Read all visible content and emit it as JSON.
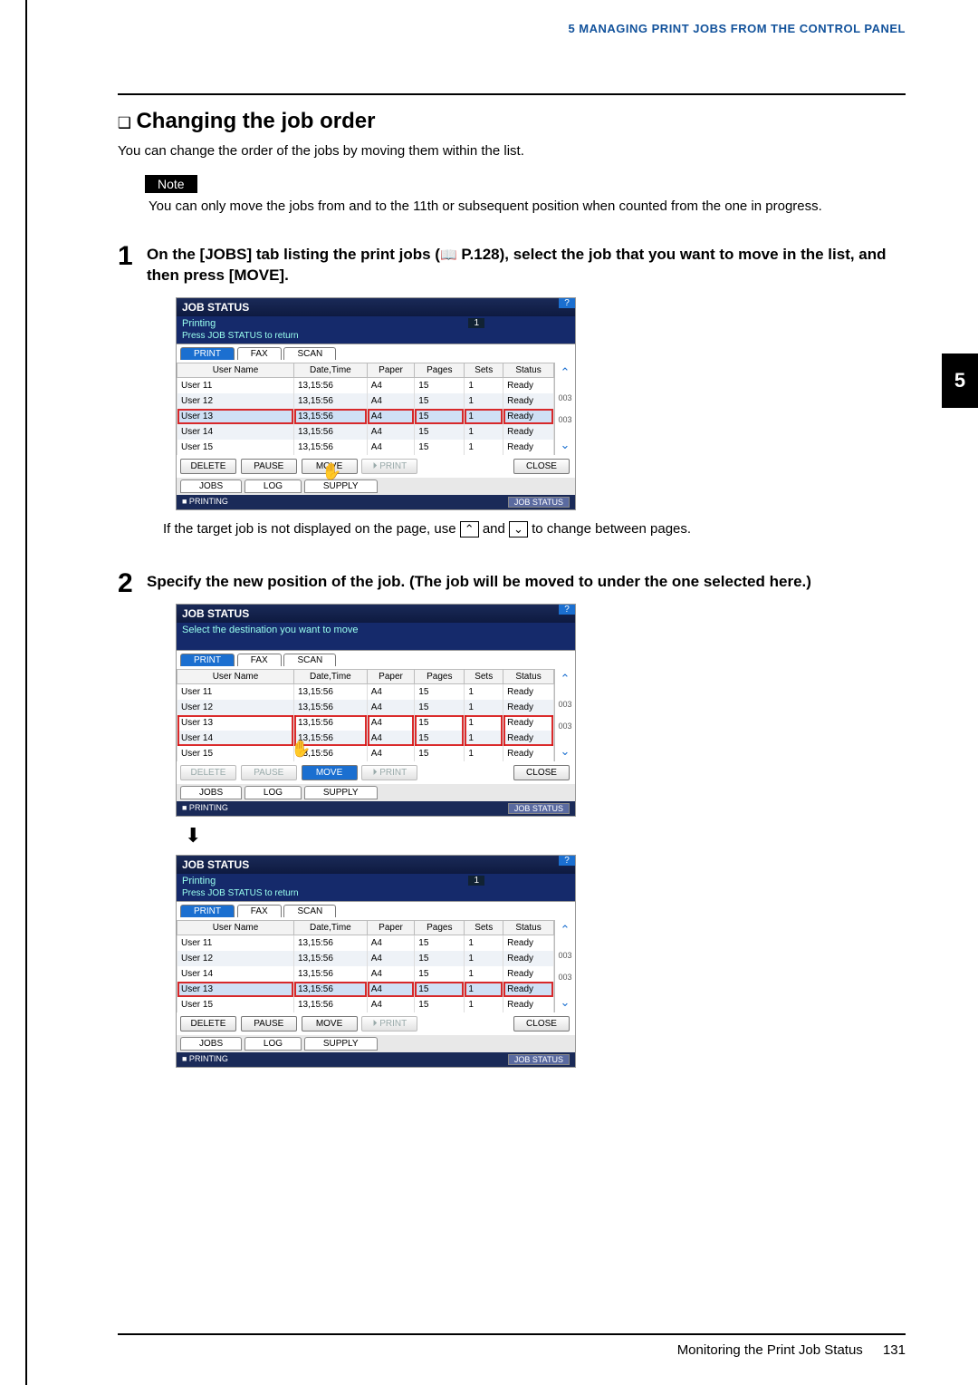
{
  "header": "5 MANAGING PRINT JOBS FROM THE CONTROL PANEL",
  "side_chapter": "5",
  "section": {
    "bullet": "❑",
    "title": "Changing the job order"
  },
  "intro": "You can change the order of the jobs by moving them within the list.",
  "note": {
    "label": "Note",
    "text": "You can only move the jobs from and to the 11th or subsequent position when counted from the one in progress."
  },
  "step1": {
    "num": "1",
    "text_a": "On the [JOBS] tab listing the print jobs (",
    "icon": "📖",
    "text_b": " P.128), select the job that you want to move in the list, and then press [MOVE]."
  },
  "mid": {
    "a": "If the target job is not displayed on the page, use ",
    "up": "⌃",
    "and": " and ",
    "down": "⌄",
    "b": " to change between pages."
  },
  "step2": {
    "num": "2",
    "text": "Specify the new position of the job. (The job will be moved to under the one selected here.)"
  },
  "panel": {
    "title": "JOB STATUS",
    "help": "?",
    "sub_printing": "Printing",
    "one": "1",
    "sub_press": "Press JOB STATUS to return",
    "sub_move": "Select the destination you want to move",
    "tabs": {
      "print": "PRINT",
      "fax": "FAX",
      "scan": "SCAN"
    },
    "cols": {
      "user": "User Name",
      "dt": "Date,Time",
      "paper": "Paper",
      "pages": "Pages",
      "sets": "Sets",
      "status": "Status"
    },
    "scroll": {
      "count": "003",
      "count2": "003"
    },
    "btns": {
      "delete": "DELETE",
      "pause": "PAUSE",
      "move": "MOVE",
      "print": "PRINT",
      "close": "CLOSE",
      "printicon": "⏵"
    },
    "subtabs": {
      "jobs": "JOBS",
      "log": "LOG",
      "supply": "SUPPLY"
    },
    "footer": {
      "printing": "■ PRINTING",
      "jobstatus": "JOB STATUS"
    }
  },
  "panel1_rows": [
    {
      "u": "User 11",
      "dt": "13,15:56",
      "p": "A4",
      "pg": "15",
      "s": "1",
      "st": "Ready"
    },
    {
      "u": "User 12",
      "dt": "13,15:56",
      "p": "A4",
      "pg": "15",
      "s": "1",
      "st": "Ready"
    },
    {
      "u": "User 13",
      "dt": "13,15:56",
      "p": "A4",
      "pg": "15",
      "s": "1",
      "st": "Ready"
    },
    {
      "u": "User 14",
      "dt": "13,15:56",
      "p": "A4",
      "pg": "15",
      "s": "1",
      "st": "Ready"
    },
    {
      "u": "User 15",
      "dt": "13,15:56",
      "p": "A4",
      "pg": "15",
      "s": "1",
      "st": "Ready"
    }
  ],
  "panel2_rows": [
    {
      "u": "User 11",
      "dt": "13,15:56",
      "p": "A4",
      "pg": "15",
      "s": "1",
      "st": "Ready"
    },
    {
      "u": "User 12",
      "dt": "13,15:56",
      "p": "A4",
      "pg": "15",
      "s": "1",
      "st": "Ready"
    },
    {
      "u": "User 13",
      "dt": "13,15:56",
      "p": "A4",
      "pg": "15",
      "s": "1",
      "st": "Ready"
    },
    {
      "u": "User 14",
      "dt": "13,15:56",
      "p": "A4",
      "pg": "15",
      "s": "1",
      "st": "Ready"
    },
    {
      "u": "User 15",
      "dt": "13,15:56",
      "p": "A4",
      "pg": "15",
      "s": "1",
      "st": "Ready"
    }
  ],
  "panel3_rows": [
    {
      "u": "User 11",
      "dt": "13,15:56",
      "p": "A4",
      "pg": "15",
      "s": "1",
      "st": "Ready"
    },
    {
      "u": "User 12",
      "dt": "13,15:56",
      "p": "A4",
      "pg": "15",
      "s": "1",
      "st": "Ready"
    },
    {
      "u": "User 14",
      "dt": "13,15:56",
      "p": "A4",
      "pg": "15",
      "s": "1",
      "st": "Ready"
    },
    {
      "u": "User 13",
      "dt": "13,15:56",
      "p": "A4",
      "pg": "15",
      "s": "1",
      "st": "Ready"
    },
    {
      "u": "User 15",
      "dt": "13,15:56",
      "p": "A4",
      "pg": "15",
      "s": "1",
      "st": "Ready"
    }
  ],
  "downarrow": "⬇",
  "cursor": "↖",
  "footer": {
    "text": "Monitoring the Print Job Status",
    "page": "131"
  }
}
